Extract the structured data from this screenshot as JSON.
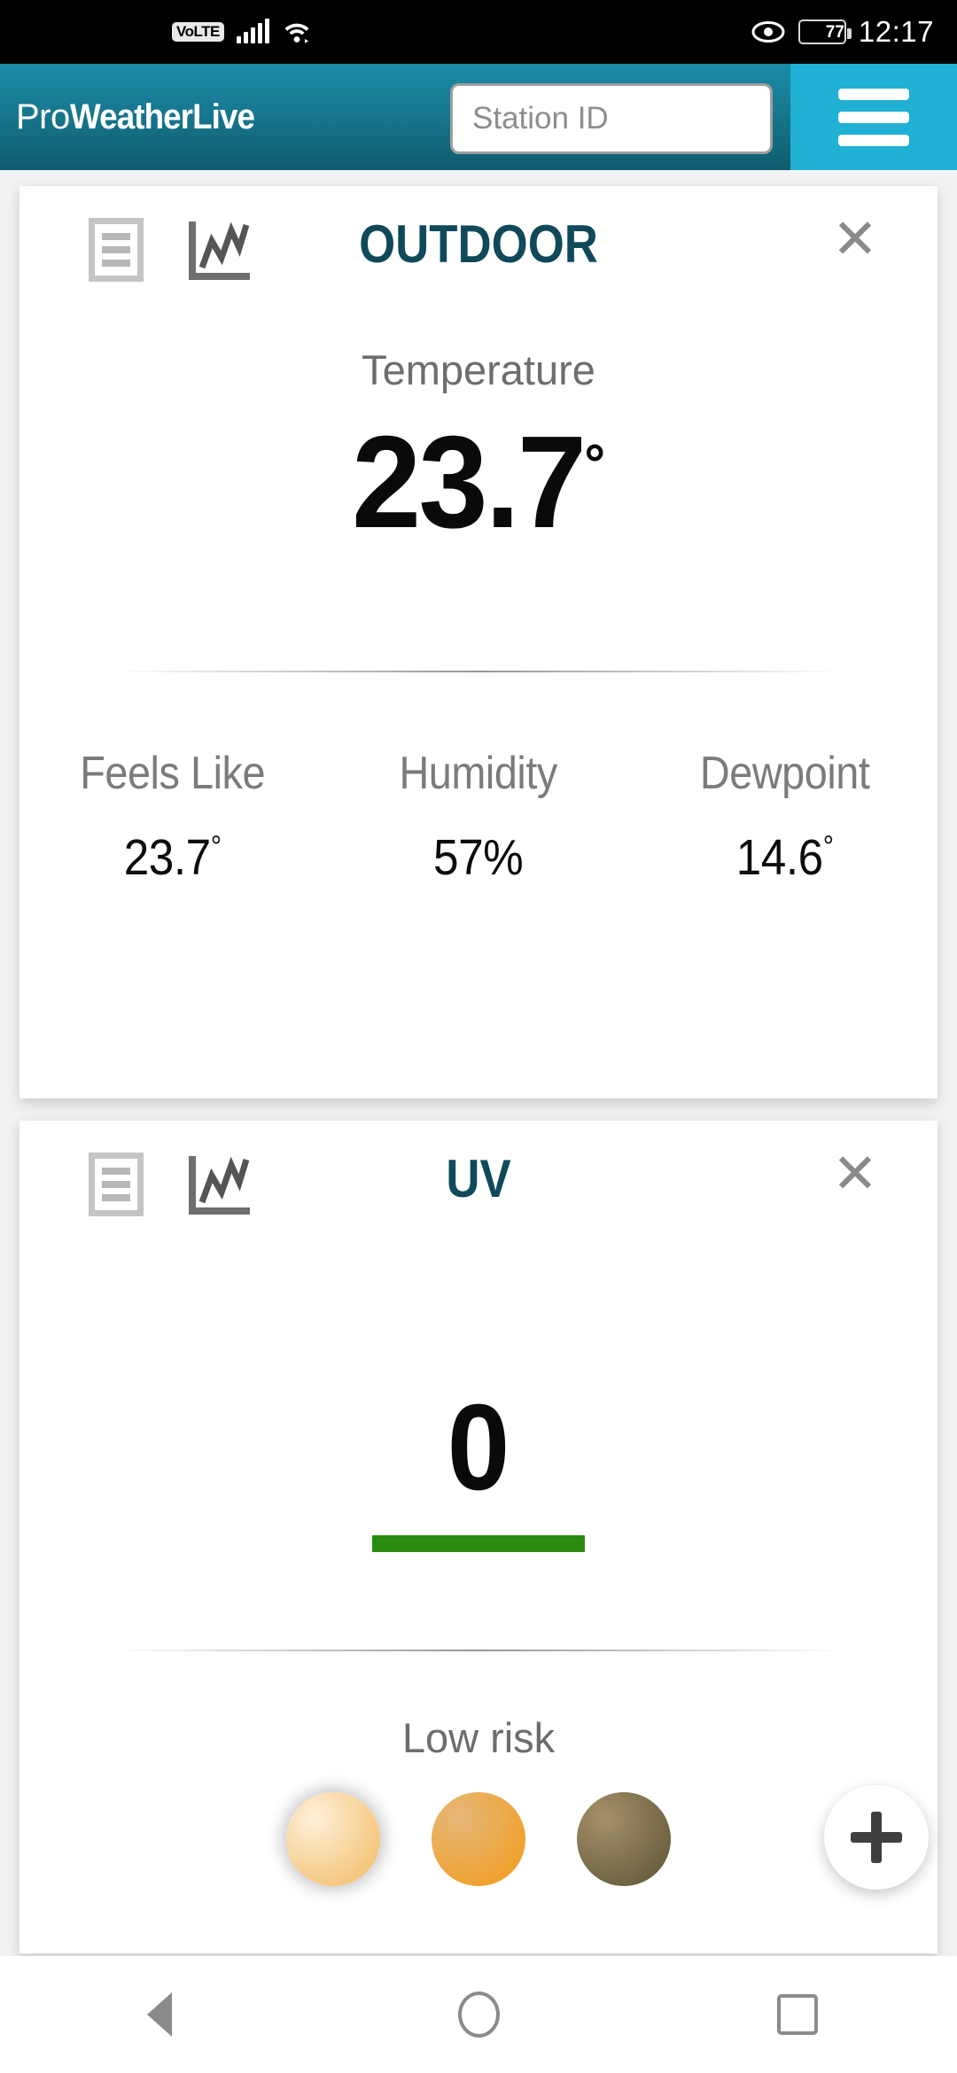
{
  "status_bar": {
    "volte_label": "VoLTE",
    "signal_icon": "signal-bars-icon",
    "wifi_icon": "wifi-icon",
    "eye_icon": "eye-comfort-icon",
    "battery_percent": "77",
    "time": "12:17"
  },
  "app_header": {
    "brand_prefix": "Pro",
    "brand_main": "WeatherLive",
    "station_placeholder": "Station ID",
    "station_value": "",
    "menu_icon": "hamburger-menu-icon",
    "gradient_top": "#1b8ba8",
    "gradient_bottom": "#0f5b6d",
    "menu_bg": "#1fb0d4"
  },
  "cards": [
    {
      "id": "outdoor",
      "title": "OUTDOOR",
      "title_color": "#104a5a",
      "list_icon": "list-view-icon",
      "chart_icon": "line-chart-icon",
      "close_icon": "close-icon",
      "metric_label": "Temperature",
      "metric_value": "23.7",
      "metric_unit": "°",
      "stats": [
        {
          "label": "Feels Like",
          "value": "23.7",
          "unit": "°"
        },
        {
          "label": "Humidity",
          "value": "57",
          "unit": "%"
        },
        {
          "label": "Dewpoint",
          "value": "14.6",
          "unit": "°"
        }
      ]
    },
    {
      "id": "uv",
      "title": "UV",
      "title_color": "#104a5a",
      "list_icon": "list-view-icon",
      "chart_icon": "line-chart-icon",
      "close_icon": "close-icon",
      "value": "0",
      "bar_color": "#2a8a12",
      "risk_label": "Low risk",
      "skin_tones": [
        {
          "name": "skin-tone-light",
          "from": "#fdf0d8",
          "to": "#f5c77f",
          "selected": true
        },
        {
          "name": "skin-tone-medium",
          "from": "#e6b87a",
          "to": "#f0a22f",
          "selected": false
        },
        {
          "name": "skin-tone-dark",
          "from": "#a5906a",
          "to": "#6e6242",
          "selected": false
        }
      ]
    }
  ],
  "fab": {
    "label": "+",
    "icon": "plus-icon"
  },
  "nav_bar": {
    "back_icon": "back-triangle-icon",
    "home_icon": "home-circle-icon",
    "recents_icon": "recents-square-icon"
  }
}
